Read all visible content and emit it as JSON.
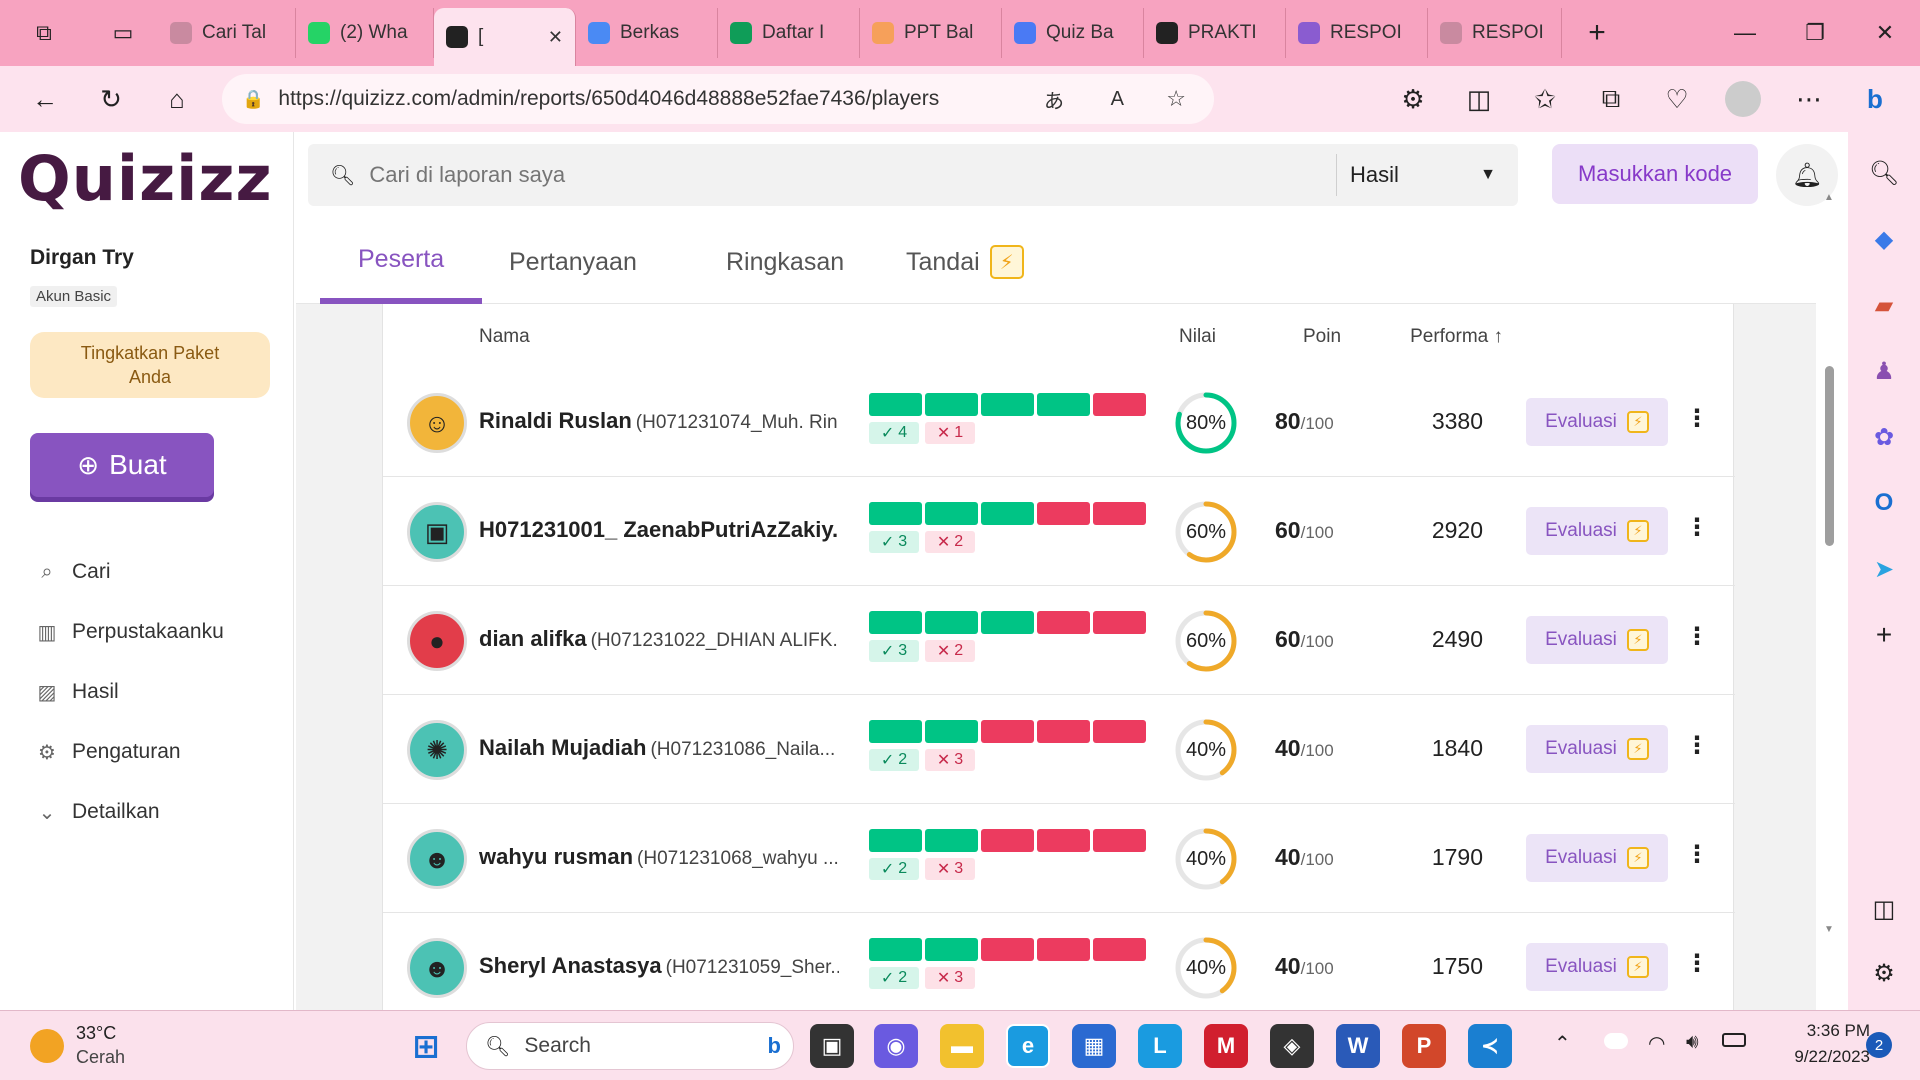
{
  "browser": {
    "tabs": [
      {
        "title": "Cari Tal",
        "icon": "chatgpt-icon",
        "color": "#c98aa0"
      },
      {
        "title": "(2) Wha",
        "icon": "whatsapp-icon",
        "color": "#25d366"
      },
      {
        "title": "[",
        "icon": "quizizz-icon",
        "color": "#222222",
        "active": true
      },
      {
        "title": "Berkas",
        "icon": "google-drive-icon",
        "color": "#4a8af4"
      },
      {
        "title": "Daftar I",
        "icon": "sheets-icon",
        "color": "#0f9d58"
      },
      {
        "title": "PPT Bal",
        "icon": "slides-icon",
        "color": "#f6a05a"
      },
      {
        "title": "Quiz Ba",
        "icon": "docs-icon",
        "color": "#4a7af4"
      },
      {
        "title": "PRAKTI",
        "icon": "quizizz-icon",
        "color": "#222222"
      },
      {
        "title": "RESPOI",
        "icon": "forms-icon",
        "color": "#8a5cd0"
      },
      {
        "title": "RESPOI",
        "icon": "forms-icon",
        "color": "#c98aa0"
      }
    ],
    "url": "https://quizizz.com/admin/reports/650d4046d48888e52fae7436/players"
  },
  "sidebar": {
    "logo": "Quizizz",
    "user_name": "Dirgan Try",
    "account_type": "Akun Basic",
    "upgrade_label": "Tingkatkan Paket Anda",
    "create_label": "Buat",
    "nav": [
      {
        "label": "Cari",
        "icon": "explore-icon"
      },
      {
        "label": "Perpustakaanku",
        "icon": "library-icon"
      },
      {
        "label": "Hasil",
        "icon": "reports-icon"
      },
      {
        "label": "Pengaturan",
        "icon": "settings-icon"
      },
      {
        "label": "Detailkan",
        "icon": "chevron-down-icon"
      }
    ]
  },
  "header": {
    "search_placeholder": "Cari di laporan saya",
    "filter_value": "Hasil",
    "enter_code_label": "Masukkan kode"
  },
  "tabs": [
    "Peserta",
    "Pertanyaan",
    "Ringkasan",
    "Tandai"
  ],
  "table": {
    "columns": {
      "name": "Nama",
      "score": "Nilai",
      "points": "Poin",
      "performance": "Performa ↑"
    },
    "score_suffix": "/100",
    "evaluate_label": "Evaluasi",
    "rows": [
      {
        "name": "Rinaldi Ruslan",
        "id": "(H071231074_Muh. Rin...",
        "correct": 4,
        "wrong": 1,
        "percent_label": "80%",
        "percent": 0.8,
        "score": "80",
        "points": "3380",
        "avatar_color": "#f2b53a",
        "ring_color": "#00c485"
      },
      {
        "name": "H071231001_ ZaenabPutriAzZakiy...",
        "id": "",
        "correct": 3,
        "wrong": 2,
        "percent_label": "60%",
        "percent": 0.6,
        "score": "60",
        "points": "2920",
        "avatar_color": "#4cc2b4",
        "ring_color": "#efa929"
      },
      {
        "name": "dian alifka",
        "id": "(H071231022_DHIAN ALIFK...",
        "correct": 3,
        "wrong": 2,
        "percent_label": "60%",
        "percent": 0.6,
        "score": "60",
        "points": "2490",
        "avatar_color": "#e23d4a",
        "ring_color": "#efa929"
      },
      {
        "name": "Nailah Mujadiah",
        "id": "(H071231086_Naila...",
        "correct": 2,
        "wrong": 3,
        "percent_label": "40%",
        "percent": 0.4,
        "score": "40",
        "points": "1840",
        "avatar_color": "#4cc2b4",
        "ring_color": "#efa929"
      },
      {
        "name": "wahyu rusman",
        "id": "(H071231068_wahyu ...",
        "correct": 2,
        "wrong": 3,
        "percent_label": "40%",
        "percent": 0.4,
        "score": "40",
        "points": "1790",
        "avatar_color": "#4cc2b4",
        "ring_color": "#efa929"
      },
      {
        "name": "Sheryl Anastasya",
        "id": "(H071231059_Sher...",
        "correct": 2,
        "wrong": 3,
        "percent_label": "40%",
        "percent": 0.4,
        "score": "40",
        "points": "1750",
        "avatar_color": "#4cc2b4",
        "ring_color": "#efa929"
      }
    ]
  },
  "taskbar": {
    "weather_temp": "33°C",
    "weather_desc": "Cerah",
    "search_label": "Search",
    "time": "3:36 PM",
    "date": "9/22/2023",
    "notification_count": "2"
  }
}
